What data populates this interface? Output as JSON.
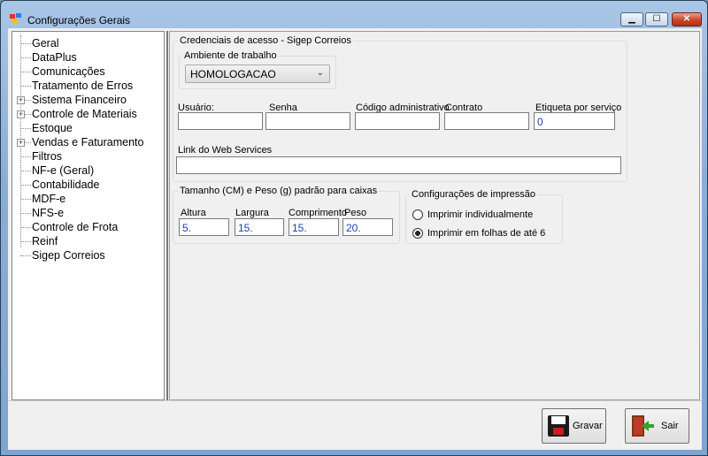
{
  "window": {
    "title": "Configurações Gerais",
    "min_glyph": "▁",
    "max_glyph": "☐",
    "close_glyph": "✕"
  },
  "tree": {
    "items": [
      {
        "label": "Geral",
        "expandable": false
      },
      {
        "label": "DataPlus",
        "expandable": false
      },
      {
        "label": "Comunicações",
        "expandable": false
      },
      {
        "label": "Tratamento de Erros",
        "expandable": false
      },
      {
        "label": "Sistema Financeiro",
        "expandable": true
      },
      {
        "label": "Controle de Materiais",
        "expandable": true
      },
      {
        "label": "Estoque",
        "expandable": false
      },
      {
        "label": "Vendas e Faturamento",
        "expandable": true
      },
      {
        "label": "Filtros",
        "expandable": false
      },
      {
        "label": "NF-e (Geral)",
        "expandable": false
      },
      {
        "label": "Contabilidade",
        "expandable": false
      },
      {
        "label": "MDF-e",
        "expandable": false
      },
      {
        "label": "NFS-e",
        "expandable": false
      },
      {
        "label": "Controle de Frota",
        "expandable": false
      },
      {
        "label": "Reinf",
        "expandable": false
      },
      {
        "label": "Sigep Correios",
        "expandable": false
      }
    ],
    "expander_glyph": "+"
  },
  "credenciais": {
    "title": "Credenciais de acesso - Sigep Correios",
    "ambiente": {
      "title": "Ambiente de trabalho",
      "selected": "HOMOLOGACAO",
      "arrow": "⌄"
    },
    "usuario_label": "Usuário:",
    "usuario_value": "",
    "senha_label": "Senha",
    "senha_value": "",
    "codigo_label": "Código administrativo",
    "codigo_value": "",
    "contrato_label": "Contrato",
    "contrato_value": "",
    "etiqueta_label": "Etiqueta por serviço",
    "etiqueta_value": "0",
    "link_label": "Link do Web Services",
    "link_value": ""
  },
  "tamanho": {
    "title": "Tamanho (CM) e Peso (g) padrão para caixas",
    "altura_label": "Altura",
    "altura_value": "5.",
    "largura_label": "Largura",
    "largura_value": "15.",
    "comprimento_label": "Comprimento",
    "comprimento_value": "15.",
    "peso_label": "Peso",
    "peso_value": "20."
  },
  "impressao": {
    "title": "Configurações de impressão",
    "opt1_label": "Imprimir individualmente",
    "opt1_selected": false,
    "opt2_label": "Imprimir em folhas de até 6",
    "opt2_selected": true
  },
  "buttons": {
    "gravar_label": "Gravar",
    "sair_label": "Sair"
  },
  "colors": {
    "value_text": "#1e3fb3",
    "close_button": "#c7452a"
  }
}
